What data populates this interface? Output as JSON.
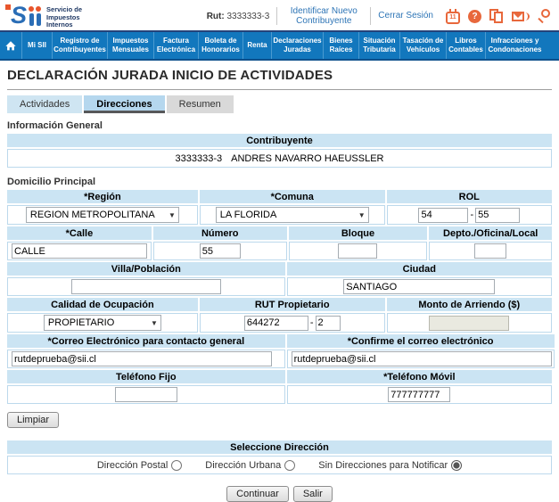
{
  "header": {
    "tagline_1": "Servicio de",
    "tagline_2": "Impuestos",
    "tagline_3": "Internos",
    "rut_label": "Rut:",
    "rut_value": "3333333-3",
    "link_identificar": "Identificar Nuevo Contribuyente",
    "link_cerrar": "Cerrar Sesión",
    "calendar_day": "11",
    "help_glyph": "?"
  },
  "nav": {
    "items": [
      "Mi SII",
      "Registro de Contribuyentes",
      "Impuestos Mensuales",
      "Factura Electrónica",
      "Boleta de Honorarios",
      "Renta",
      "Declaraciones Juradas",
      "Bienes Raíces",
      "Situación Tributaria",
      "Tasación de Vehículos",
      "Libros Contables",
      "Infracciones y Condonaciones"
    ]
  },
  "page": {
    "title": "DECLARACIÓN JURADA INICIO DE ACTIVIDADES",
    "tab_actividades": "Actividades",
    "tab_direcciones": "Direcciones",
    "tab_resumen": "Resumen"
  },
  "info_general": {
    "section_title": "Información General",
    "contribuyente_header": "Contribuyente",
    "contribuyente_rut": "3333333-3",
    "contribuyente_nombre": "ANDRES NAVARRO HAEUSSLER"
  },
  "domicilio": {
    "section_title": "Domicilio Principal",
    "region_label": "*Región",
    "region_value": "REGION METROPOLITANA",
    "comuna_label": "*Comuna",
    "comuna_value": "LA FLORIDA",
    "rol_label": "ROL",
    "rol_value1": "54",
    "rol_sep": "-",
    "rol_value2": "55",
    "calle_label": "*Calle",
    "calle_value": "CALLE",
    "numero_label": "Número",
    "numero_value": "55",
    "bloque_label": "Bloque",
    "bloque_value": "",
    "depto_label": "Depto./Oficina/Local",
    "depto_value": "",
    "villa_label": "Villa/Población",
    "villa_value": "",
    "ciudad_label": "Ciudad",
    "ciudad_value": "SANTIAGO",
    "calidad_label": "Calidad de Ocupación",
    "calidad_value": "PROPIETARIO",
    "rut_prop_label": "RUT Propietario",
    "rut_prop_value1": "644272",
    "rut_prop_sep": "-",
    "rut_prop_value2": "2",
    "monto_label": "Monto de Arriendo ($)",
    "monto_value": "",
    "correo_label": "*Correo Electrónico para contacto general",
    "correo_value": "rutdeprueba@sii.cl",
    "confirme_label": "*Confirme el correo electrónico",
    "confirme_value": "rutdeprueba@sii.cl",
    "fijo_label": "Teléfono Fijo",
    "fijo_value": "",
    "movil_label": "*Teléfono Móvil",
    "movil_value": "777777777",
    "limpiar_button": "Limpiar"
  },
  "seleccion": {
    "header": "Seleccione Dirección",
    "options": [
      {
        "label": "Dirección Postal"
      },
      {
        "label": "Dirección Urbana"
      },
      {
        "label": "Sin Direcciones para Notificar",
        "checked": "checked"
      }
    ]
  },
  "footer": {
    "continuar": "Continuar",
    "salir": "Salir"
  },
  "colors": {
    "nav_blue": "#1277bd",
    "navy": "#24437a",
    "orange": "#e8683c",
    "header_blue": "#cbe4f3",
    "link_blue": "#2e75b6"
  }
}
